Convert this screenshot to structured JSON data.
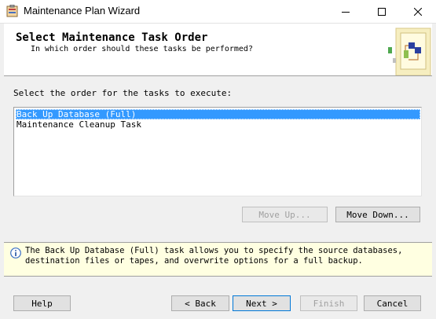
{
  "window": {
    "title": "Maintenance Plan Wizard",
    "icon": "wizard-app-icon",
    "controls": [
      "minimize-icon",
      "maximize-icon",
      "close-icon"
    ]
  },
  "header": {
    "title": "Select Maintenance Task Order",
    "subtitle": "In which order should these tasks be performed?",
    "graphic": "wizard-graphic-icon"
  },
  "main": {
    "instruction": "Select the order for the tasks to execute:",
    "tasks": [
      {
        "label": "Back Up Database (Full)",
        "selected": true
      },
      {
        "label": "Maintenance Cleanup Task",
        "selected": false
      }
    ],
    "move_up_label": "Move Up...",
    "move_down_label": "Move Down..."
  },
  "info": {
    "icon": "info-icon",
    "line1": "The Back Up Database (Full) task allows you to specify the source databases,",
    "line2": "destination files or tapes, and overwrite options for a full backup."
  },
  "footer": {
    "help_label": "Help",
    "back_label": "< Back",
    "next_label": "Next >",
    "finish_label": "Finish",
    "cancel_label": "Cancel"
  },
  "colors": {
    "selection": "#3399ff",
    "info_background": "#ffffe1",
    "focus_border": "#0078d7"
  }
}
